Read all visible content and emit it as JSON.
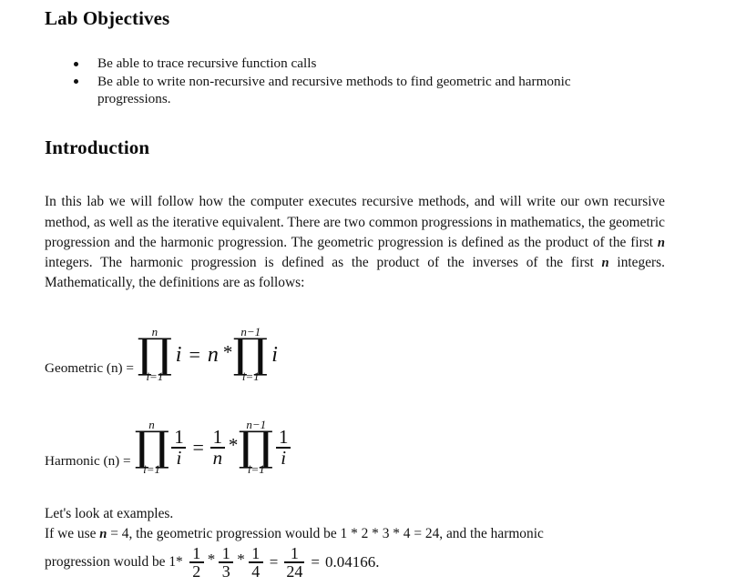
{
  "document": {
    "background_color": "#ffffff",
    "text_color": "#131313"
  },
  "sections": {
    "objectives": {
      "heading": "Lab Objectives",
      "bullets": [
        "Be able to trace recursive function calls",
        "Be able to write non-recursive and recursive methods to find geometric and harmonic progressions."
      ]
    },
    "introduction": {
      "heading": "Introduction",
      "paragraph": {
        "part1": "In this lab we will follow how the computer executes recursive methods, and will write our own recursive method, as well as the iterative equivalent. There are two common progressions in mathematics, the geometric progression and the harmonic progression. The geometric progression is defined as the product of the first ",
        "var1": "n",
        "part2": " integers. The harmonic progression is defined as the product of the inverses of the first ",
        "var2": "n",
        "part3": " integers. Mathematically, the definitions are as follows:"
      }
    }
  },
  "formulas": {
    "geometric": {
      "label": "Geometric (n) =",
      "product1": {
        "symbol": "∏",
        "upper_limit": "n",
        "lower_limit": "i=1",
        "operand": "i"
      },
      "equals": "=",
      "factor": "n",
      "times": "*",
      "product2": {
        "symbol": "∏",
        "upper_limit": "n−1",
        "lower_limit": "i=1",
        "operand": "i"
      }
    },
    "harmonic": {
      "label": "Harmonic (n) =",
      "product1": {
        "symbol": "∏",
        "upper_limit": "n",
        "lower_limit": "i=1",
        "operand_numerator": "1",
        "operand_denominator": "i"
      },
      "equals": "=",
      "factor_numerator": "1",
      "factor_denominator": "n",
      "times": "*",
      "product2": {
        "symbol": "∏",
        "upper_limit": "n−1",
        "lower_limit": "i=1",
        "operand_numerator": "1",
        "operand_denominator": "i"
      }
    }
  },
  "examples": {
    "line1": "Let's look at examples.",
    "line2_part1": "If we use ",
    "line2_var": "n",
    "line2_part2": " = 4, the geometric progression would be 1 * 2 * 3 * 4 = 24, and the harmonic",
    "final": {
      "lead": "progression would be 1*",
      "f1_num": "1",
      "f1_den": "2",
      "op1": "*",
      "f2_num": "1",
      "f2_den": "3",
      "op2": "*",
      "f3_num": "1",
      "f3_den": "4",
      "eq1": "=",
      "f4_num": "1",
      "f4_den": "24",
      "eq2": "=",
      "result": "0.04166."
    }
  }
}
